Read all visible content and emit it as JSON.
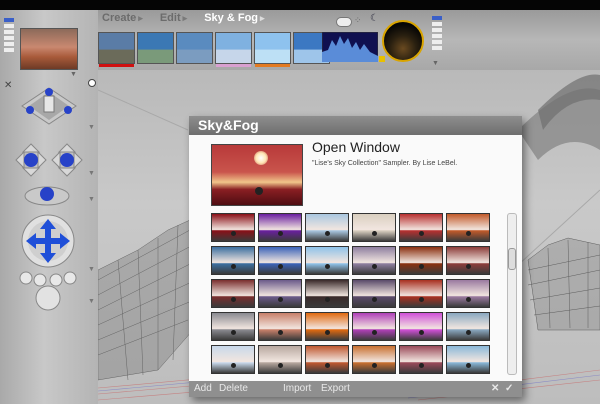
{
  "breadcrumb": {
    "create": "Create",
    "edit": "Edit",
    "current": "Sky & Fog"
  },
  "dialog": {
    "title": "Sky&Fog",
    "open_window": "Open Window",
    "description": "\"Lise's Sky Collection\" Sampler.  By Lise LeBel.",
    "footer": {
      "add": "Add",
      "delete": "Delete",
      "import": "Import",
      "export": "Export",
      "cancel": "✕",
      "ok": "✓"
    }
  },
  "toolbar_thumbnails": [
    {
      "sky": "#5a7ca6",
      "ground": "#6b6b5a",
      "bar": "#d01010"
    },
    {
      "sky": "#3b78b4",
      "ground": "#7a9a7a",
      "bar": ""
    },
    {
      "sky": "#5a8bbf",
      "ground": "#7b9cc0",
      "bar": ""
    },
    {
      "sky": "#7fb1e0",
      "ground": "#c6d6ea",
      "bar": "#d8a0d0"
    },
    {
      "sky": "#8ec2ee",
      "ground": "#bde0f5",
      "bar": "#e37a20"
    },
    {
      "sky": "#3c78c2",
      "ground": "#9ec5ea",
      "bar": ""
    }
  ],
  "sky_presets": [
    [
      "#8a1018",
      "#6a1fa0",
      "#a9c7e0",
      "#d9cfc0",
      "#b83030",
      "#c25a2a"
    ],
    [
      "#3c6fa0",
      "#3b63b8",
      "#8fc2e8",
      "#8e7fa0",
      "#8a3010",
      "#8c3d3a"
    ],
    [
      "#7a2e2e",
      "#6b5a8a",
      "#3a2a2a",
      "#5a4a6a",
      "#a83020",
      "#9a7aa0"
    ],
    [
      "#8a8a90",
      "#c8806a",
      "#e06a10",
      "#b040b8",
      "#d050d8",
      "#8aa8c0"
    ],
    [
      "#c8d8ea",
      "#b8a8a0",
      "#c05830",
      "#c87030",
      "#9a4a5a",
      "#8ab8d8"
    ]
  ],
  "colors": {
    "dialog_title": "#787878",
    "panel": "#bdbdbd",
    "accent_blue": "#1f4fd8"
  }
}
